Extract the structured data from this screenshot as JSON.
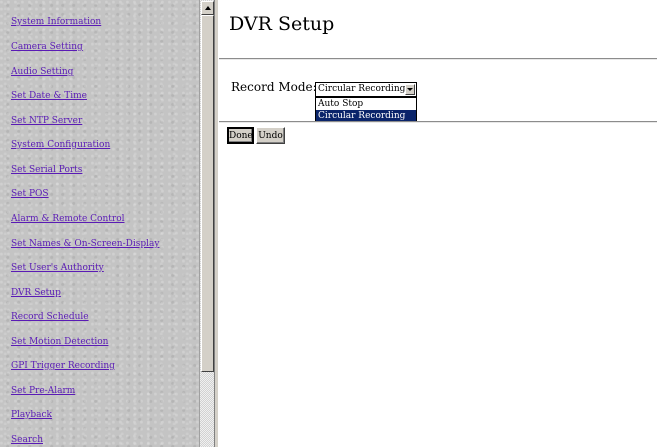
{
  "sidebar": {
    "items": [
      {
        "label": "System Information"
      },
      {
        "label": "Camera Setting"
      },
      {
        "label": "Audio Setting"
      },
      {
        "label": "Set Date & Time"
      },
      {
        "label": "Set NTP Server"
      },
      {
        "label": "System Configuration"
      },
      {
        "label": "Set Serial Ports"
      },
      {
        "label": "Set POS"
      },
      {
        "label": "Alarm & Remote Control"
      },
      {
        "label": "Set Names & On-Screen-Display"
      },
      {
        "label": "Set User's Authority"
      },
      {
        "label": "DVR Setup"
      },
      {
        "label": "Record Schedule"
      },
      {
        "label": "Set Motion Detection"
      },
      {
        "label": "GPI Trigger Recording"
      },
      {
        "label": "Set Pre-Alarm"
      },
      {
        "label": "Playback"
      },
      {
        "label": "Search"
      }
    ]
  },
  "main": {
    "title": "DVR Setup",
    "record_mode": {
      "label": "Record Mode:",
      "selected": "Circular Recording",
      "options": [
        "Auto Stop",
        "Circular Recording"
      ],
      "highlighted": "Circular Recording"
    },
    "buttons": {
      "done": "Done",
      "undo": "Undo"
    }
  },
  "colors": {
    "link": "#5a1bb5",
    "visited_link": "#5a1bb5",
    "sidebar_bg": "#c4c4c4",
    "selection": "#0a246a"
  }
}
